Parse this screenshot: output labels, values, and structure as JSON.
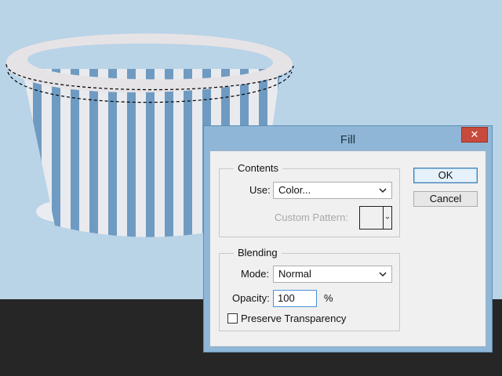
{
  "dialog": {
    "title": "Fill",
    "close_glyph": "✕",
    "contents": {
      "legend": "Contents",
      "use_label": "Use:",
      "use_value": "Color...",
      "custom_pattern_label": "Custom Pattern:"
    },
    "blending": {
      "legend": "Blending",
      "mode_label": "Mode:",
      "mode_value": "Normal",
      "opacity_label": "Opacity:",
      "opacity_value": "100",
      "opacity_unit": "%",
      "preserve_label": "Preserve Transparency",
      "preserve_checked": false
    },
    "buttons": {
      "ok": "OK",
      "cancel": "Cancel"
    }
  },
  "colors": {
    "canvas_bg": "#b9d3e7",
    "basket_stripe_light": "#e8eaee",
    "basket_stripe_blue": "#6f9bc2",
    "rim": "#e6e3e6",
    "dialog_frame": "#8fb6d6",
    "close_button": "#c74a3c"
  },
  "icons": {
    "close": "close-icon",
    "dropdown": "chevron-down-icon"
  }
}
